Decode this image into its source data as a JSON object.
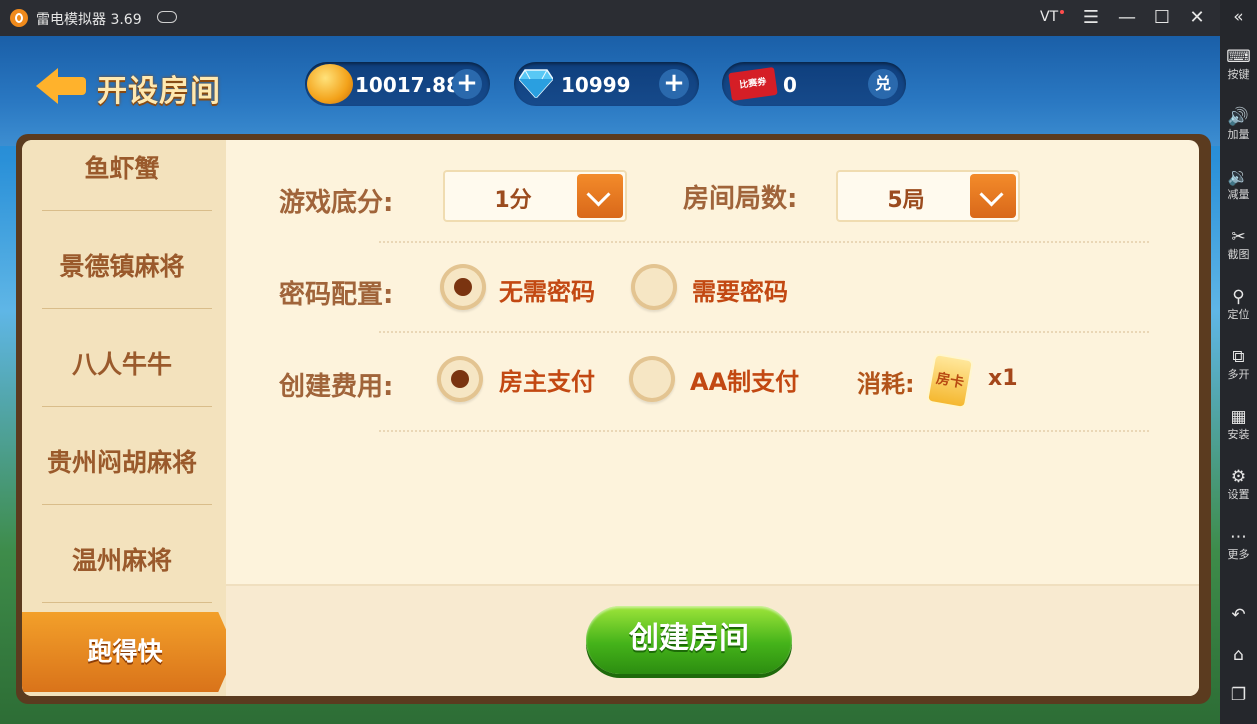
{
  "emulator": {
    "app_title": "雷电模拟器 3.69",
    "vt_label": "VT",
    "sidebar": [
      {
        "label": "按键",
        "icon": "keyboard-icon"
      },
      {
        "label": "加量",
        "icon": "volume-up-icon"
      },
      {
        "label": "减量",
        "icon": "volume-down-icon"
      },
      {
        "label": "截图",
        "icon": "scissors-icon"
      },
      {
        "label": "定位",
        "icon": "location-icon"
      },
      {
        "label": "多开",
        "icon": "multi-instance-icon"
      },
      {
        "label": "安装",
        "icon": "apk-icon"
      },
      {
        "label": "设置",
        "icon": "gear-icon"
      },
      {
        "label": "更多",
        "icon": "more-icon"
      }
    ]
  },
  "header": {
    "title": "开设房间",
    "gold": "10017.88",
    "diamonds": "10999",
    "tickets": "0",
    "ticket_icon_text": "比赛券",
    "redeem_label": "兑"
  },
  "tabs": [
    {
      "label": "鱼虾蟹"
    },
    {
      "label": "景德镇麻将"
    },
    {
      "label": "八人牛牛"
    },
    {
      "label": "贵州闷胡麻将"
    },
    {
      "label": "温州麻将"
    },
    {
      "label": "跑得快",
      "active": true
    }
  ],
  "form": {
    "base_score_label": "游戏底分:",
    "base_score_value": "1分",
    "rounds_label": "房间局数:",
    "rounds_value": "5局",
    "password_label": "密码配置:",
    "password_options": [
      "无需密码",
      "需要密码"
    ],
    "password_selected": 0,
    "fee_label": "创建费用:",
    "fee_options": [
      "房主支付",
      "AA制支付"
    ],
    "fee_selected": 0,
    "consume_label": "消耗:",
    "card_text": "房卡",
    "consume_qty": "x1"
  },
  "actions": {
    "create_label": "创建房间"
  },
  "colors": {
    "accent_orange": "#f38b2a",
    "create_green": "#45b31a",
    "label_brown": "#a0643a"
  }
}
